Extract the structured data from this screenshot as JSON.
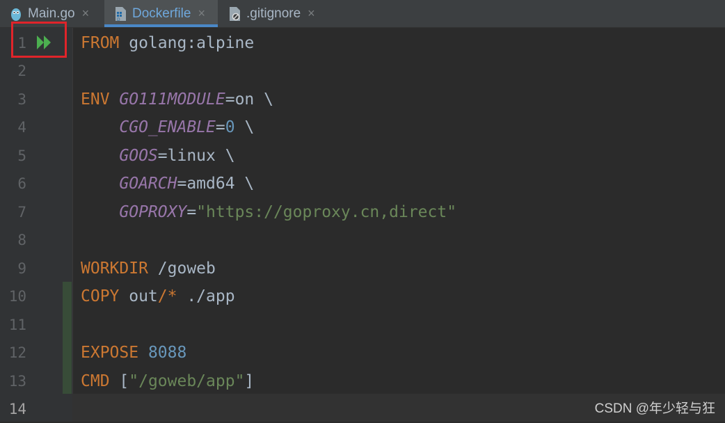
{
  "tabs": [
    {
      "label": "Main.go",
      "icon": "gopher-icon",
      "active": false
    },
    {
      "label": "Dockerfile",
      "icon": "docker-file-icon",
      "active": true
    },
    {
      "label": ".gitignore",
      "icon": "gitignore-file-icon",
      "active": false
    }
  ],
  "tab_close_glyph": "×",
  "line_numbers": [
    "1",
    "2",
    "3",
    "4",
    "5",
    "6",
    "7",
    "8",
    "9",
    "10",
    "11",
    "12",
    "13",
    "14"
  ],
  "code": {
    "l1": {
      "kw": "FROM",
      "rest": " golang:alpine"
    },
    "l3": {
      "kw": "ENV",
      "var": "GO111MODULE",
      "eq": "=on \\"
    },
    "l4": {
      "var": "CGO_ENABLE",
      "eq": "=",
      "num": "0",
      "tail": " \\"
    },
    "l5": {
      "var": "GOOS",
      "eq": "=linux \\"
    },
    "l6": {
      "var": "GOARCH",
      "eq": "=amd64 \\"
    },
    "l7": {
      "var": "GOPROXY",
      "eq": "=",
      "str": "\"https://goproxy.cn,direct\""
    },
    "l9": {
      "kw": "WORKDIR",
      "rest": " /goweb"
    },
    "l10": {
      "kw": "COPY",
      "a": " out",
      "star": "/*",
      "b": " ./app"
    },
    "l12": {
      "kw": "EXPOSE",
      "num": "8088"
    },
    "l13": {
      "kw": "CMD",
      "open": " [",
      "str": "\"/goweb/app\"",
      "close": "]"
    }
  },
  "colors": {
    "keyword": "#cc7832",
    "variable": "#9876aa",
    "string": "#6a8759",
    "number": "#6897bb",
    "run_icon": "#4caf50",
    "highlight_box": "#e0242a"
  },
  "watermark": "CSDN @年少轻与狂"
}
